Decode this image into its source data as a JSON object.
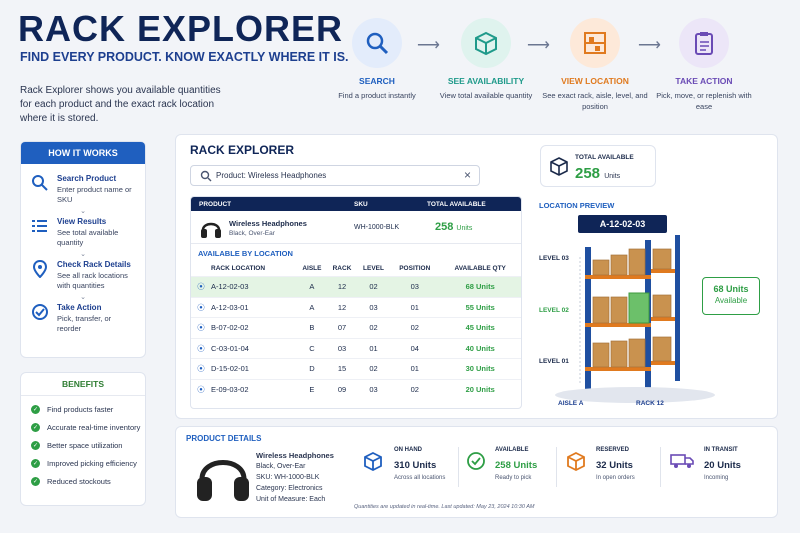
{
  "header": {
    "title": "RACK EXPLORER",
    "tagline": "FIND EVERY PRODUCT. KNOW EXACTLY WHERE IT IS.",
    "intro": "Rack Explorer shows you available quantities for each product and the exact rack location where it is stored."
  },
  "steps": [
    {
      "icon": "search-icon",
      "title": "SEARCH",
      "desc": "Find a product instantly",
      "color": "#1f5fbf",
      "bg": "#e3ecfb"
    },
    {
      "icon": "box-icon",
      "title": "SEE AVAILABILITY",
      "desc": "View total available quantity",
      "color": "#1f9a8a",
      "bg": "#dff3ee"
    },
    {
      "icon": "rack-icon",
      "title": "VIEW LOCATION",
      "desc": "See exact rack, aisle, level, and position",
      "color": "#e07a1f",
      "bg": "#fde9d9"
    },
    {
      "icon": "clipboard-icon",
      "title": "TAKE ACTION",
      "desc": "Pick, move, or replenish with ease",
      "color": "#6a4bb5",
      "bg": "#ece6f8"
    }
  ],
  "how": {
    "title": "HOW IT WORKS",
    "items": [
      {
        "title": "Search Product",
        "desc": "Enter product name or SKU"
      },
      {
        "title": "View Results",
        "desc": "See total available quantity"
      },
      {
        "title": "Check Rack Details",
        "desc": "See all rack locations with quantities"
      },
      {
        "title": "Take Action",
        "desc": "Pick, transfer, or reorder"
      }
    ]
  },
  "benefits": {
    "title": "BENEFITS",
    "items": [
      "Find products faster",
      "Accurate real-time inventory",
      "Better space utilization",
      "Improved picking efficiency",
      "Reduced stockouts"
    ]
  },
  "explorer": {
    "title": "RACK EXPLORER",
    "search_value": "Product: Wireless Headphones",
    "clear": "×",
    "prod_cols": [
      "PRODUCT",
      "SKU",
      "TOTAL AVAILABLE"
    ],
    "product": {
      "name": "Wireless Headphones",
      "variant": "Black, Over-Ear",
      "sku": "WH-1000-BLK",
      "qty": "258",
      "unit": "Units"
    },
    "by_loc_title": "AVAILABLE BY LOCATION",
    "loc_cols": [
      "RACK LOCATION",
      "AISLE",
      "RACK",
      "LEVEL",
      "POSITION",
      "AVAILABLE QTY"
    ],
    "rows": [
      {
        "loc": "A-12-02-03",
        "aisle": "A",
        "rack": "12",
        "level": "02",
        "pos": "03",
        "qty": "68 Units"
      },
      {
        "loc": "A-12-03-01",
        "aisle": "A",
        "rack": "12",
        "level": "03",
        "pos": "01",
        "qty": "55 Units"
      },
      {
        "loc": "B-07-02-02",
        "aisle": "B",
        "rack": "07",
        "level": "02",
        "pos": "02",
        "qty": "45 Units"
      },
      {
        "loc": "C-03-01-04",
        "aisle": "C",
        "rack": "03",
        "level": "01",
        "pos": "04",
        "qty": "40 Units"
      },
      {
        "loc": "D-15-02-01",
        "aisle": "D",
        "rack": "15",
        "level": "02",
        "pos": "01",
        "qty": "30 Units"
      },
      {
        "loc": "E-09-03-02",
        "aisle": "E",
        "rack": "09",
        "level": "03",
        "pos": "02",
        "qty": "20 Units"
      }
    ]
  },
  "total": {
    "label": "TOTAL AVAILABLE",
    "value": "258",
    "unit": "Units"
  },
  "preview": {
    "title": "LOCATION PREVIEW",
    "loc": "A-12-02-03",
    "levels": [
      "LEVEL 03",
      "LEVEL 02",
      "LEVEL 01"
    ],
    "callout_qty": "68 Units",
    "callout_label": "Available",
    "aisle": "AISLE A",
    "rack": "RACK 12"
  },
  "details": {
    "title": "PRODUCT DETAILS",
    "name": "Wireless Headphones",
    "variant": "Black, Over-Ear",
    "sku": "SKU: WH-1000-BLK",
    "category": "Category: Electronics",
    "uom": "Unit of Measure: Each",
    "stats": [
      {
        "icon": "box-icon",
        "label": "ON HAND",
        "value": "310 Units",
        "sub": "Across all locations",
        "color": "#1f5fbf"
      },
      {
        "icon": "check-circle-icon",
        "label": "AVAILABLE",
        "value": "258 Units",
        "sub": "Ready to pick",
        "color": "#2e9e45"
      },
      {
        "icon": "box-orange-icon",
        "label": "RESERVED",
        "value": "32 Units",
        "sub": "In open orders",
        "color": "#e07a1f"
      },
      {
        "icon": "truck-icon",
        "label": "IN TRANSIT",
        "value": "20 Units",
        "sub": "Incoming",
        "color": "#6a4bb5"
      }
    ],
    "footnote": "Quantities are updated in real-time. Last updated: May 23, 2024 10:30 AM"
  }
}
